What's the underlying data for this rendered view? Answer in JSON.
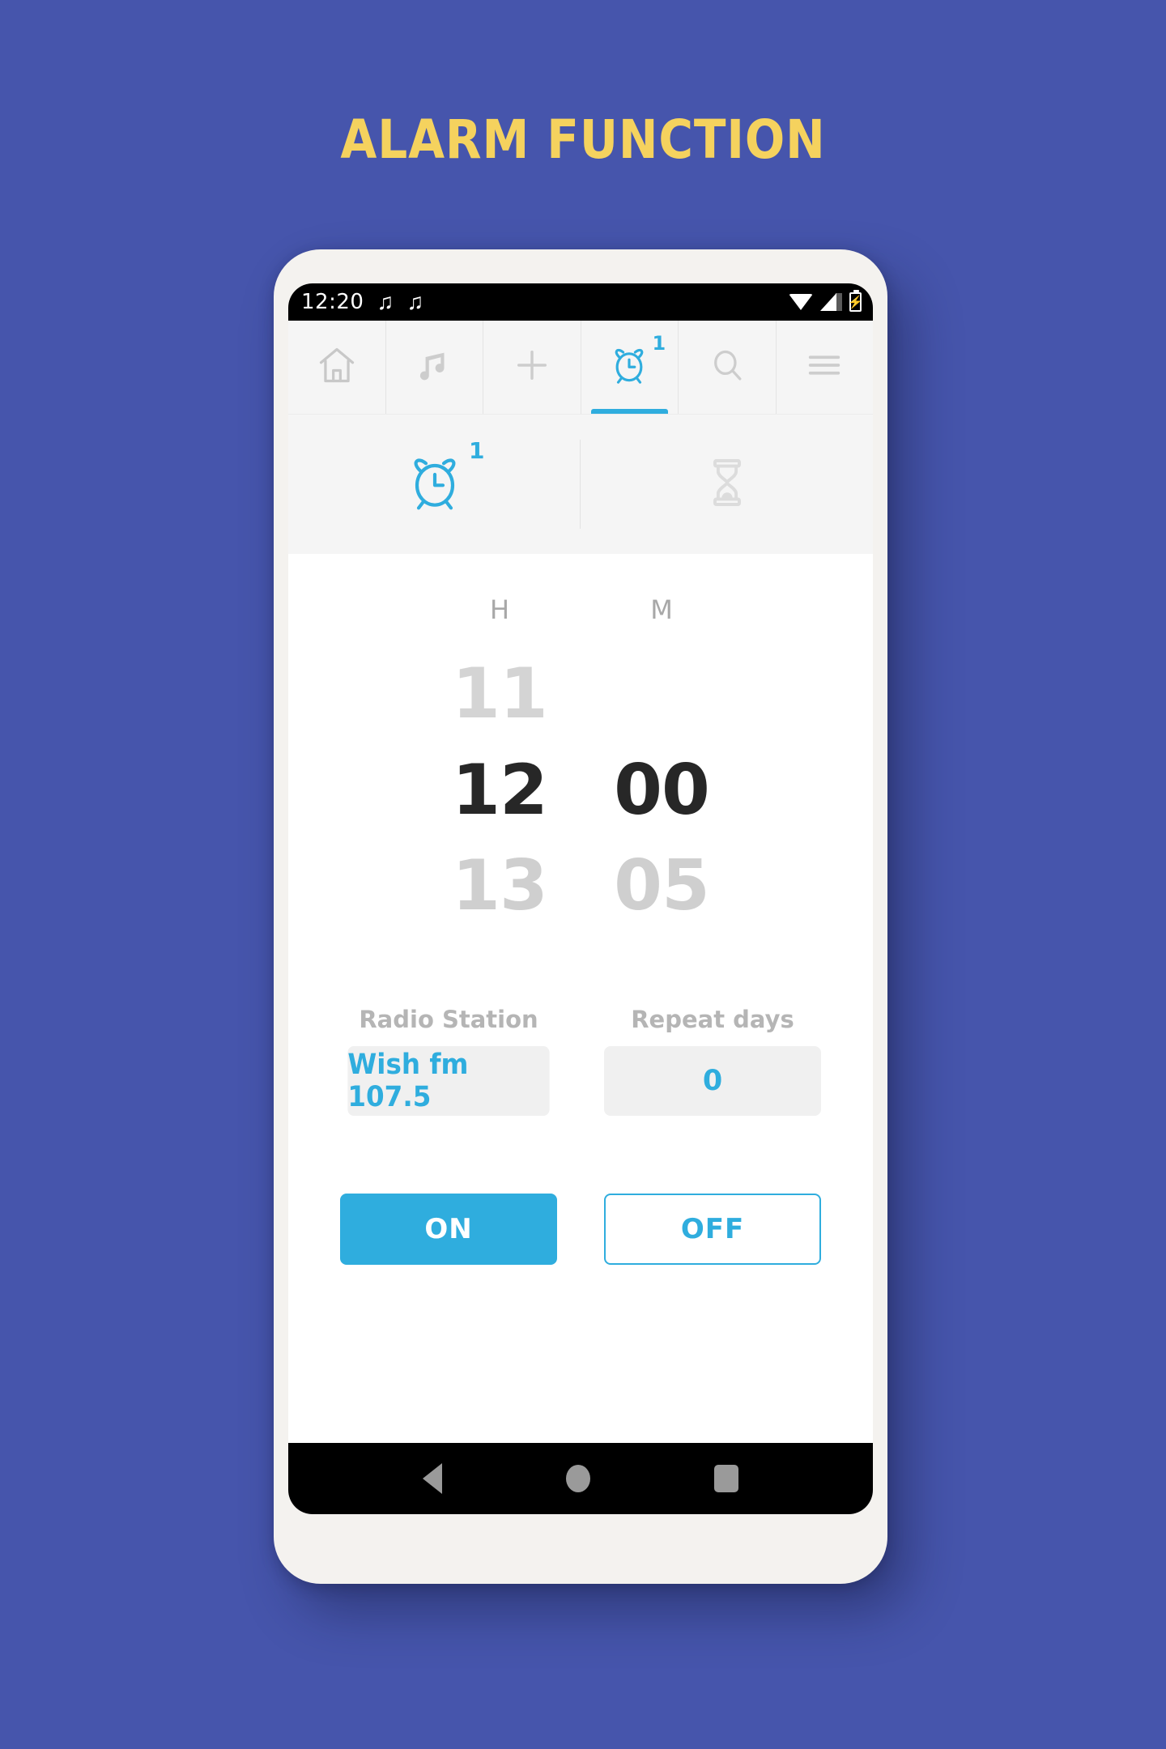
{
  "page": {
    "title": "ALARM FUNCTION",
    "background_color": "#4655ac",
    "title_color": "#f5d25e",
    "accent_color": "#2fadde"
  },
  "status_bar": {
    "time": "12:20",
    "note_icon_1": "music-note-icon",
    "note_icon_2": "music-note-icon",
    "note_glyph_1": "♫",
    "note_glyph_2": "♫",
    "wifi_icon": "wifi-icon",
    "signal_icon": "signal-icon",
    "battery_icon": "battery-charging-icon",
    "battery_glyph": "⚡"
  },
  "top_nav": {
    "items": [
      {
        "name": "home",
        "icon": "home-icon",
        "active": false,
        "badge": ""
      },
      {
        "name": "music",
        "icon": "music-note-icon",
        "active": false,
        "badge": ""
      },
      {
        "name": "add",
        "icon": "plus-icon",
        "active": false,
        "badge": ""
      },
      {
        "name": "alarm",
        "icon": "alarm-clock-icon",
        "active": true,
        "badge": "1"
      },
      {
        "name": "search",
        "icon": "search-icon",
        "active": false,
        "badge": ""
      },
      {
        "name": "menu",
        "icon": "hamburger-menu-icon",
        "active": false,
        "badge": ""
      }
    ]
  },
  "sub_tabs": {
    "items": [
      {
        "name": "alarm",
        "icon": "alarm-clock-icon",
        "active": true,
        "badge": "1"
      },
      {
        "name": "timer",
        "icon": "hourglass-icon",
        "active": false,
        "badge": ""
      }
    ]
  },
  "time_picker": {
    "hour_header": "H",
    "minute_header": "M",
    "hours": {
      "prev": "11",
      "current": "12",
      "next": "13"
    },
    "minutes": {
      "prev": "",
      "current": "00",
      "next": "05"
    }
  },
  "fields": {
    "radio_station": {
      "label": "Radio Station",
      "value": "Wish fm 107.5"
    },
    "repeat_days": {
      "label": "Repeat days",
      "value": "0"
    }
  },
  "buttons": {
    "on_label": "ON",
    "off_label": "OFF"
  },
  "android_nav": {
    "back": "back-icon",
    "home": "home-circle-icon",
    "recents": "recents-square-icon"
  }
}
